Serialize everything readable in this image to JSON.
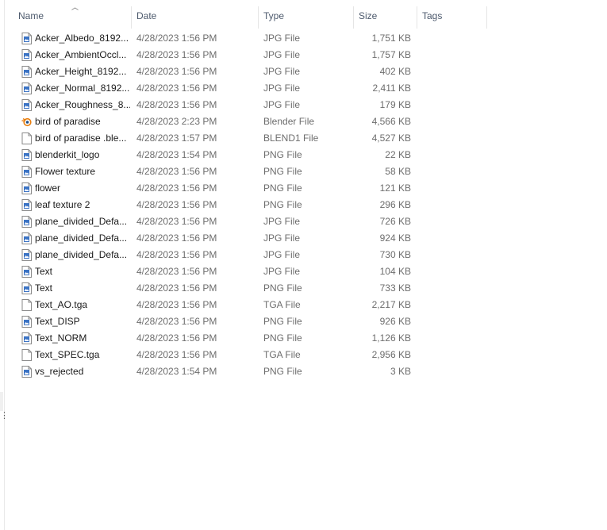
{
  "columns": {
    "name": "Name",
    "date": "Date",
    "type": "Type",
    "size": "Size",
    "tags": "Tags"
  },
  "files": [
    {
      "name": "Acker_Albedo_8192...",
      "date": "4/28/2023 1:56 PM",
      "type": "JPG File",
      "size": "1,751 KB",
      "icon": "image-file-icon"
    },
    {
      "name": "Acker_AmbientOccl...",
      "date": "4/28/2023 1:56 PM",
      "type": "JPG File",
      "size": "1,757 KB",
      "icon": "image-file-icon"
    },
    {
      "name": "Acker_Height_8192...",
      "date": "4/28/2023 1:56 PM",
      "type": "JPG File",
      "size": "402 KB",
      "icon": "image-file-icon"
    },
    {
      "name": "Acker_Normal_8192...",
      "date": "4/28/2023 1:56 PM",
      "type": "JPG File",
      "size": "2,411 KB",
      "icon": "image-file-icon"
    },
    {
      "name": "Acker_Roughness_8...",
      "date": "4/28/2023 1:56 PM",
      "type": "JPG File",
      "size": "179 KB",
      "icon": "image-file-icon"
    },
    {
      "name": "bird of paradise",
      "date": "4/28/2023 2:23 PM",
      "type": "Blender File",
      "size": "4,566 KB",
      "icon": "blender-file-icon"
    },
    {
      "name": "bird of paradise .ble...",
      "date": "4/28/2023 1:57 PM",
      "type": "BLEND1 File",
      "size": "4,527 KB",
      "icon": "generic-file-icon"
    },
    {
      "name": "blenderkit_logo",
      "date": "4/28/2023 1:54 PM",
      "type": "PNG File",
      "size": "22 KB",
      "icon": "image-file-icon"
    },
    {
      "name": "Flower texture",
      "date": "4/28/2023 1:56 PM",
      "type": "PNG File",
      "size": "58 KB",
      "icon": "image-file-icon"
    },
    {
      "name": "flower",
      "date": "4/28/2023 1:56 PM",
      "type": "PNG File",
      "size": "121 KB",
      "icon": "image-file-icon"
    },
    {
      "name": "leaf texture 2",
      "date": "4/28/2023 1:56 PM",
      "type": "PNG File",
      "size": "296 KB",
      "icon": "image-file-icon"
    },
    {
      "name": "plane_divided_Defa...",
      "date": "4/28/2023 1:56 PM",
      "type": "JPG File",
      "size": "726 KB",
      "icon": "image-file-icon"
    },
    {
      "name": "plane_divided_Defa...",
      "date": "4/28/2023 1:56 PM",
      "type": "JPG File",
      "size": "924 KB",
      "icon": "image-file-icon"
    },
    {
      "name": "plane_divided_Defa...",
      "date": "4/28/2023 1:56 PM",
      "type": "JPG File",
      "size": "730 KB",
      "icon": "image-file-icon"
    },
    {
      "name": "Text",
      "date": "4/28/2023 1:56 PM",
      "type": "JPG File",
      "size": "104 KB",
      "icon": "image-file-icon"
    },
    {
      "name": "Text",
      "date": "4/28/2023 1:56 PM",
      "type": "PNG File",
      "size": "733 KB",
      "icon": "image-file-icon"
    },
    {
      "name": "Text_AO.tga",
      "date": "4/28/2023 1:56 PM",
      "type": "TGA File",
      "size": "2,217 KB",
      "icon": "generic-file-icon"
    },
    {
      "name": "Text_DISP",
      "date": "4/28/2023 1:56 PM",
      "type": "PNG File",
      "size": "926 KB",
      "icon": "image-file-icon"
    },
    {
      "name": "Text_NORM",
      "date": "4/28/2023 1:56 PM",
      "type": "PNG File",
      "size": "1,126 KB",
      "icon": "image-file-icon"
    },
    {
      "name": "Text_SPEC.tga",
      "date": "4/28/2023 1:56 PM",
      "type": "TGA File",
      "size": "2,956 KB",
      "icon": "generic-file-icon"
    },
    {
      "name": "vs_rejected",
      "date": "4/28/2023 1:54 PM",
      "type": "PNG File",
      "size": "3 KB",
      "icon": "image-file-icon"
    }
  ],
  "colors": {
    "header_text": "#4d5a6d",
    "image_icon_accent": "#3b73c4",
    "blender_orange": "#e87d0d"
  }
}
